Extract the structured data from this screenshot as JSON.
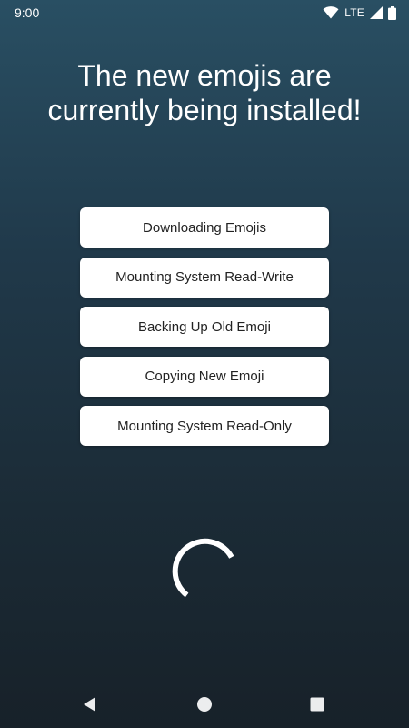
{
  "status_bar": {
    "time": "9:00",
    "network": "LTE",
    "icons": [
      "wifi-icon",
      "signal-icon",
      "battery-icon"
    ]
  },
  "title": {
    "line1": "The new emojis are",
    "line2": "currently being installed!"
  },
  "steps": [
    {
      "label": "Downloading Emojis"
    },
    {
      "label": "Mounting System Read-Write"
    },
    {
      "label": "Backing Up Old Emoji"
    },
    {
      "label": "Copying New Emoji"
    },
    {
      "label": "Mounting System Read-Only"
    }
  ],
  "nav_bar": {
    "icons": [
      "back-icon",
      "home-icon",
      "recents-icon"
    ]
  },
  "colors": {
    "background_top": "#294f63",
    "background_bottom": "#172129",
    "button_background": "#ffffff",
    "button_text": "#222222",
    "title_text": "#ffffff"
  }
}
